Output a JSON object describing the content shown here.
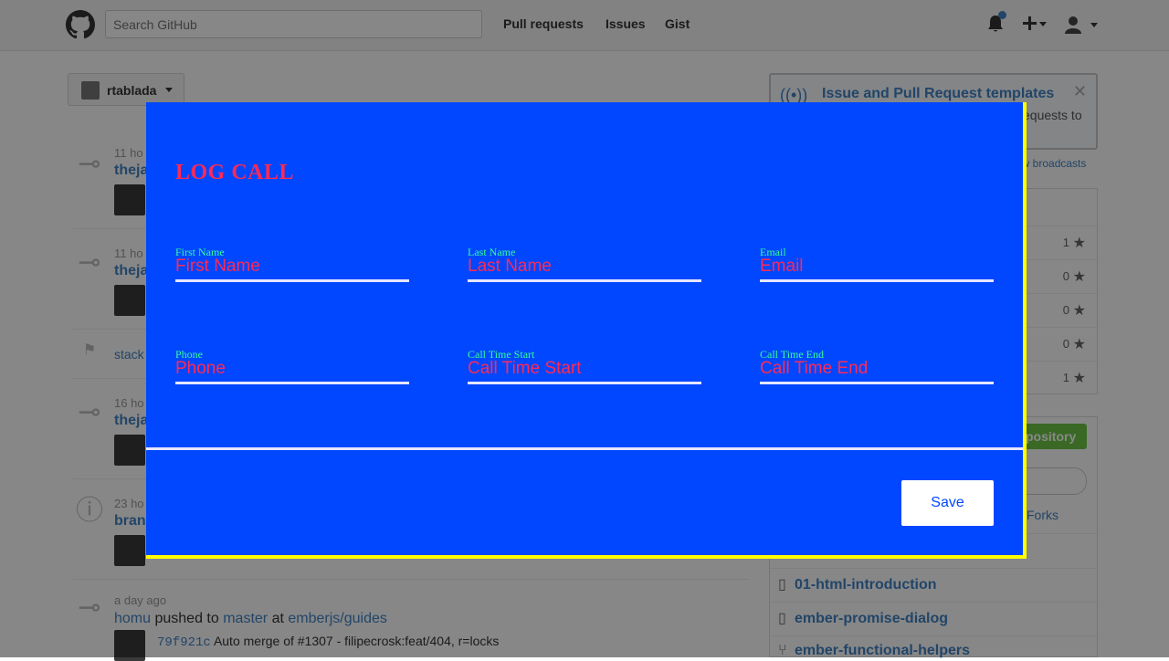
{
  "github": {
    "search_placeholder": "Search GitHub",
    "nav": [
      "Pull requests",
      "Issues",
      "Gist"
    ],
    "context_user": "rtablada"
  },
  "feed": [
    {
      "time": "11 ho",
      "title": "theja"
    },
    {
      "time": "11 ho",
      "title": "theja"
    },
    {
      "time": "",
      "title": "stack"
    },
    {
      "time": "16 ho",
      "title": "theja"
    },
    {
      "time": "23 ho",
      "title": "bran"
    }
  ],
  "bottom_feed": {
    "time": "a day ago",
    "user": "homu",
    "action_1": "pushed to",
    "branch": "master",
    "action_2": "at",
    "repo": "emberjs/guides",
    "commit_sha": "79f921c",
    "commit_msg": "Auto merge of #1307 - filipecrosk:feat/404, r=locks"
  },
  "sidebar": {
    "broadcast_title": "Issue and Pull Request templates",
    "broadcast_text": "equests to",
    "view_broadcasts": "ew broadcasts",
    "star_counts": [
      "1",
      "0",
      "0",
      "0",
      "1"
    ],
    "new_repo_label": "pository",
    "forks_label": "Forks",
    "repos": [
      "01-html-introduction",
      "ember-promise-dialog",
      "ember-functional-helpers"
    ]
  },
  "modal": {
    "title": "LOG CALL",
    "fields": [
      {
        "label": "First Name",
        "placeholder": "First Name",
        "value": ""
      },
      {
        "label": "Last Name",
        "placeholder": "Last Name",
        "value": ""
      },
      {
        "label": "Email",
        "placeholder": "Email",
        "value": ""
      },
      {
        "label": "Phone",
        "placeholder": "Phone",
        "value": ""
      },
      {
        "label": "Call Time Start",
        "placeholder": "Call Time Start",
        "value": ""
      },
      {
        "label": "Call Time End",
        "placeholder": "Call Time End",
        "value": ""
      }
    ],
    "save_label": "Save",
    "colors": {
      "background": "#0047ff",
      "border": "#ffff00",
      "title": "#ff2a55",
      "label": "#33ff99",
      "underline": "#e6e6ff"
    }
  }
}
